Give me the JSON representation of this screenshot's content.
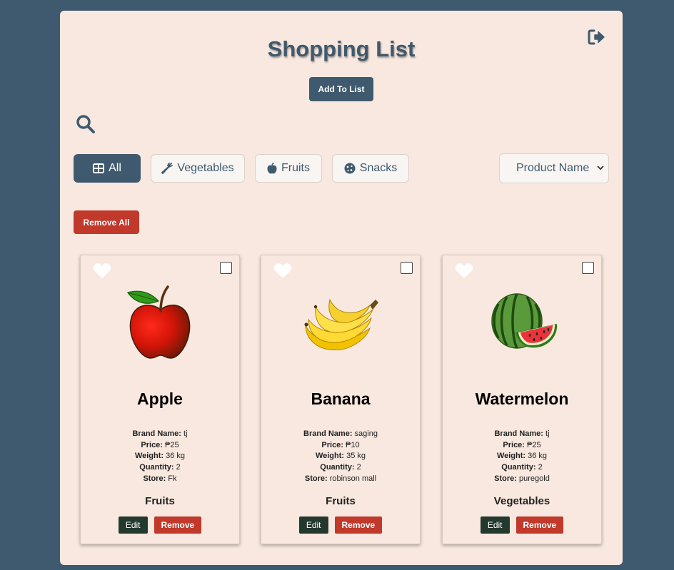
{
  "header": {
    "title": "Shopping List",
    "add_button": "Add To List",
    "logout_icon": "sign-out-icon",
    "search_icon": "search-icon"
  },
  "filters": [
    {
      "label": "All",
      "icon": "grid-icon",
      "active": true
    },
    {
      "label": "Vegetables",
      "icon": "carrot-icon",
      "active": false
    },
    {
      "label": "Fruits",
      "icon": "apple-icon",
      "active": false
    },
    {
      "label": "Snacks",
      "icon": "cookie-icon",
      "active": false
    }
  ],
  "sort": {
    "selected": "Product Name"
  },
  "remove_all_label": "Remove All",
  "labels": {
    "brand": "Brand Name:",
    "price": "Price:",
    "weight": "Weight:",
    "quantity": "Quantity:",
    "store": "Store:",
    "edit": "Edit",
    "remove": "Remove"
  },
  "items": [
    {
      "name": "Apple",
      "brand": "tj",
      "price": "₱25",
      "weight": "36 kg",
      "quantity": "2",
      "store": "Fk",
      "category": "Fruits",
      "image": "apple-image"
    },
    {
      "name": "Banana",
      "brand": "saging",
      "price": "₱10",
      "weight": "35 kg",
      "quantity": "2",
      "store": "robinson mall",
      "category": "Fruits",
      "image": "banana-image"
    },
    {
      "name": "Watermelon",
      "brand": "tj",
      "price": "₱25",
      "weight": "36 kg",
      "quantity": "2",
      "store": "puregold",
      "category": "Vegetables",
      "image": "watermelon-image"
    }
  ],
  "colors": {
    "background": "#3f5a6e",
    "panel": "#f8e8df",
    "primary": "#3f5a6e",
    "danger": "#c0392b",
    "edit": "#24392e"
  }
}
